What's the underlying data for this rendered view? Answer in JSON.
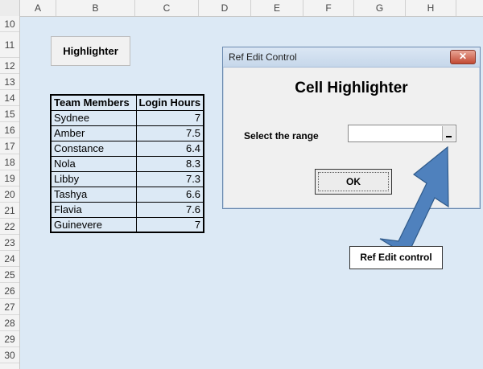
{
  "columns": [
    "A",
    "B",
    "C",
    "D",
    "E",
    "F",
    "G",
    "H"
  ],
  "rows": [
    "10",
    "11",
    "12",
    "13",
    "14",
    "15",
    "16",
    "17",
    "18",
    "19",
    "20",
    "21",
    "22",
    "23",
    "24",
    "25",
    "26",
    "27",
    "28",
    "29",
    "30"
  ],
  "sheet_button": {
    "label": "Highlighter"
  },
  "table": {
    "headers": [
      "Team Members",
      "Login Hours"
    ],
    "rows": [
      {
        "name": "Sydnee",
        "hours": "7"
      },
      {
        "name": "Amber",
        "hours": "7.5"
      },
      {
        "name": "Constance",
        "hours": "6.4"
      },
      {
        "name": "Nola",
        "hours": "8.3"
      },
      {
        "name": "Libby",
        "hours": "7.3"
      },
      {
        "name": "Tashya",
        "hours": "6.6"
      },
      {
        "name": "Flavia",
        "hours": "7.6"
      },
      {
        "name": "Guinevere",
        "hours": "7"
      }
    ]
  },
  "dialog": {
    "title": "Ref Edit Control",
    "close_label": "✕",
    "heading": "Cell Highlighter",
    "range_label": "Select the range",
    "range_value": "",
    "ok_label": "OK"
  },
  "callout": {
    "label": "Ref Edit control",
    "arrow_color": "#4f81bd"
  }
}
